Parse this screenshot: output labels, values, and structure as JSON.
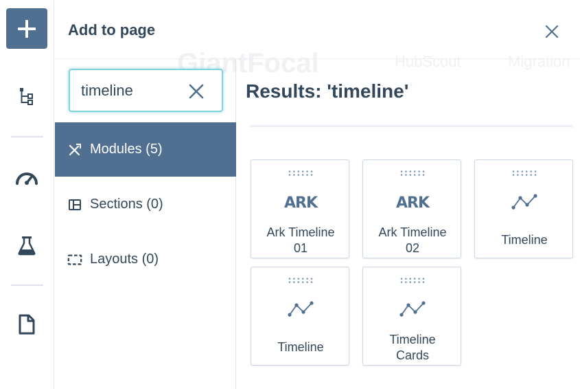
{
  "panel": {
    "title": "Add to page"
  },
  "background_page": {
    "logo_text": "GiantFocal",
    "nav_1": "HubScout",
    "nav_2": "Migration"
  },
  "search": {
    "value": "timeline",
    "placeholder": ""
  },
  "categories": [
    {
      "label": "Modules (5)",
      "active": true,
      "icon": "modules-icon"
    },
    {
      "label": "Sections (0)",
      "active": false,
      "icon": "section-icon"
    },
    {
      "label": "Layouts (0)",
      "active": false,
      "icon": "layout-icon"
    }
  ],
  "results": {
    "title": "Results: 'timeline'",
    "cards": [
      {
        "label_line1": "Ark Timeline",
        "label_line2": "01",
        "icon": "ark-logo-icon",
        "icon_text": "ARK"
      },
      {
        "label_line1": "Ark Timeline",
        "label_line2": "02",
        "icon": "ark-logo-icon",
        "icon_text": "ARK"
      },
      {
        "label_line1": "Timeline",
        "label_line2": "",
        "icon": "timeline-icon"
      },
      {
        "label_line1": "Timeline",
        "label_line2": "",
        "icon": "timeline-icon"
      },
      {
        "label_line1": "Timeline",
        "label_line2": "Cards",
        "icon": "timeline-icon"
      }
    ]
  },
  "rail": {
    "icons": [
      "add-icon",
      "tree-icon",
      "gauge-icon",
      "flask-icon",
      "page-icon"
    ]
  },
  "colors": {
    "accent": "#516f90",
    "text": "#33475b",
    "focus": "#7fd1de",
    "border": "#cbd6e2"
  }
}
